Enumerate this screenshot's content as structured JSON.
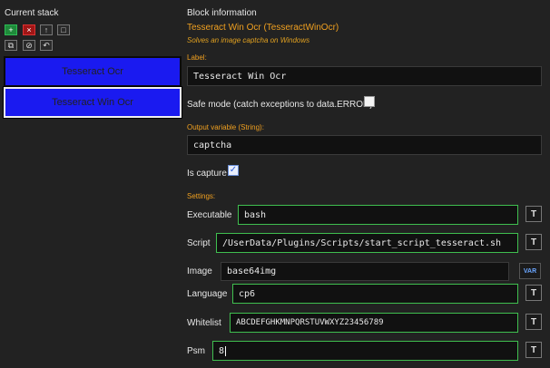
{
  "left": {
    "title": "Current stack",
    "toolbar_row1": [
      "+",
      "×",
      "↑",
      "□"
    ],
    "toolbar_row2": [
      "⧉",
      "⊘",
      "↶"
    ],
    "blocks": [
      {
        "label": "Tesseract Ocr",
        "selected": false
      },
      {
        "label": "Tesseract Win Ocr",
        "selected": true
      }
    ]
  },
  "right": {
    "title": "Block information",
    "block_name": "Tesseract Win Ocr (TesseractWinOcr)",
    "description": "Solves an image captcha on Windows",
    "label_caption": "Label:",
    "label_value": "Tesseract Win Ocr",
    "safe_mode_text": "Safe mode (catch exceptions to data.ERROR)",
    "safe_mode_checked": false,
    "output_caption": "Output variable (String):",
    "output_value": "captcha",
    "is_capture_text": "Is capture",
    "is_capture_checked": true,
    "settings_caption": "Settings:",
    "settings": {
      "executable": {
        "label": "Executable",
        "value": "bash",
        "button": "T"
      },
      "script": {
        "label": "Script",
        "value": "/UserData/Plugins/Scripts/start_script_tesseract.sh",
        "button": "T"
      },
      "image": {
        "label": "Image",
        "value": "base64img",
        "button": "VAR"
      },
      "language": {
        "label": "Language",
        "value": "cp6",
        "button": "T"
      },
      "whitelist": {
        "label": "Whitelist",
        "value": "ABCDEFGHKMNPQRSTUVWXYZ23456789",
        "button": "T"
      },
      "psm": {
        "label": "Psm",
        "value": "8",
        "button": "T"
      }
    }
  },
  "colors": {
    "background": "#222222",
    "block_fill": "#1a1af0",
    "accent_orange": "#f0a020",
    "field_active_border": "#3fbf4f"
  }
}
